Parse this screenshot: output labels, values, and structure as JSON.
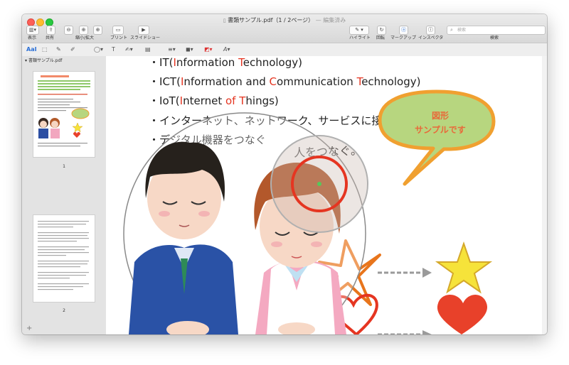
{
  "window": {
    "filename": "書類サンプル.pdf（1 / 2ページ）",
    "status": " — 編集済み"
  },
  "toolbar": {
    "view_label": "表示",
    "share_label": "共有",
    "zoom_label": "縮小/拡大",
    "print_label": "プリント",
    "slideshow_label": "スライドショー",
    "highlight_label": "ハイライト",
    "rotate_label": "回転",
    "markup_label": "マークアップ",
    "inspector_label": "インスペクタ",
    "search_label": "検索",
    "search_placeholder": "検索"
  },
  "sidebar": {
    "header": "書類サンプル.pdf",
    "pages": [
      {
        "number": "1"
      },
      {
        "number": "2"
      }
    ]
  },
  "document": {
    "lines": [
      {
        "bullet": "・",
        "parts": [
          "IT(",
          "I",
          "nformation ",
          "T",
          "echnology)"
        ]
      },
      {
        "bullet": "・",
        "parts": [
          "ICT(",
          "I",
          "nformation and ",
          "C",
          "ommunication ",
          "T",
          "echnology)"
        ]
      },
      {
        "bullet": "・",
        "parts": [
          "IoT(",
          "I",
          "nternet ",
          "of",
          " ",
          "T",
          "hings)"
        ]
      },
      {
        "bullet": "・",
        "text": "インターネット、ネットワーク、サービスに接続する。"
      },
      {
        "bullet": "・",
        "text": "デジタル機器をつなぐ"
      },
      {
        "text": "人をつなぐ。"
      }
    ],
    "bubble": {
      "line1": "図形",
      "line2": "サンプルです"
    }
  },
  "colors": {
    "accent_red": "#e53521",
    "bubble_fill": "#b7d67f",
    "bubble_border": "#f0a030",
    "star_fill": "#f6e33a",
    "heart_fill": "#e8412a",
    "sketch_orange": "#e8751c"
  }
}
